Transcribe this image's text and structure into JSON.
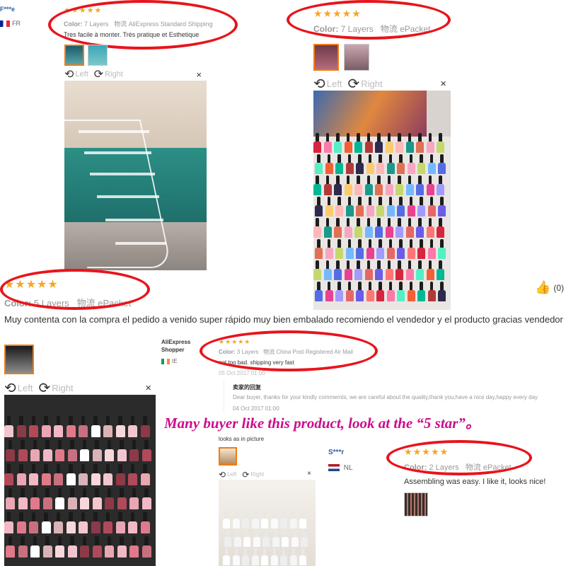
{
  "review1": {
    "user": "F***e",
    "country": "FR",
    "stars": "★★★★★",
    "color_label": "Color:",
    "color_value": "7 Layers",
    "logistics_label": "物流",
    "logistics_value": "AliExpress Standard Shipping",
    "text": "Tres facile à monter. Très pratique et Esthetique",
    "viewer": {
      "left": "Left",
      "right": "Right",
      "close": "×"
    }
  },
  "review2": {
    "stars": "★★★★★",
    "color_label": "Color:",
    "color_value": "7 Layers",
    "logistics_label": "物流",
    "logistics_value": "ePacket",
    "viewer": {
      "left": "Left",
      "right": "Right",
      "close": "×"
    },
    "likes": "(0)"
  },
  "review3": {
    "stars": "★★★★★",
    "color_label": "Color:",
    "color_value": "5 Layers",
    "logistics_label": "物流",
    "logistics_value": "ePacket",
    "text": "Muy contenta con la compra el pedido a venido super rápido muy bien embalado recomiendo el vendedor y el producto gracias vendedor",
    "viewer": {
      "left": "Left",
      "right": "Right",
      "close": "×"
    }
  },
  "review4": {
    "user_line1": "AliExpress",
    "user_line2": "Shopper",
    "country": "IE",
    "stars": "★★★★★",
    "color_label": "Color:",
    "color_value": "3 Layers",
    "logistics_label": "物流",
    "logistics_value": "China Post Registered Air Mail",
    "text": "not too bad. shipping very fast",
    "date": "05 Oct 2017 01:00",
    "seller_reply_title": "卖家的回复",
    "seller_reply": "Dear buyer, thanks for your kindly commemts, we are careful about the quality,thank you,have a nice day,happy every day",
    "reply_date": "04 Oct 2017 01:00"
  },
  "banner": "Many buyer like this product, look at the “5 star”。",
  "review5": {
    "text": "looks as in picture",
    "viewer": {
      "left": "Left",
      "right": "Right",
      "close": "×"
    }
  },
  "review6": {
    "user": "S***r",
    "country": "NL",
    "stars": "★★★★★",
    "color_label": "Color:",
    "color_value": "2 Layers",
    "logistics_label": "物流",
    "logistics_value": "ePacket",
    "text": "Assembling was easy. I like it, looks nice!"
  },
  "colors": {
    "star": "#f5a623",
    "circle": "#e8141b",
    "banner": "#cc0c8c",
    "selected": "#f07b13"
  }
}
